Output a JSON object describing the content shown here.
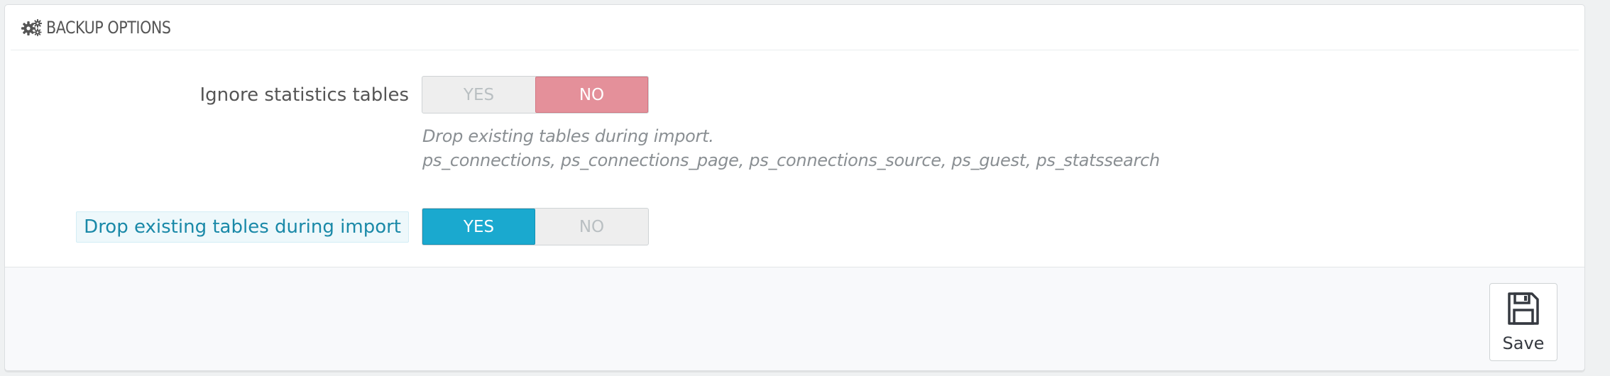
{
  "panel": {
    "title": "BACKUP OPTIONS",
    "icon": "gears-icon"
  },
  "fields": {
    "ignore_stats": {
      "label": "Ignore statistics tables",
      "yes_label": "YES",
      "no_label": "NO",
      "selected": "NO",
      "help_line1": "Drop existing tables during import.",
      "help_line2": "ps_connections, ps_connections_page, ps_connections_source, ps_guest, ps_statssearch"
    },
    "drop_tables": {
      "label": "Drop existing tables during import",
      "yes_label": "YES",
      "no_label": "NO",
      "selected": "YES"
    }
  },
  "footer": {
    "save_label": "Save",
    "save_icon": "floppy-disk-icon"
  },
  "colors": {
    "switch_no_active": "#e4909a",
    "switch_yes_active": "#1aa9cf",
    "label_highlight": "#1a89a8"
  }
}
